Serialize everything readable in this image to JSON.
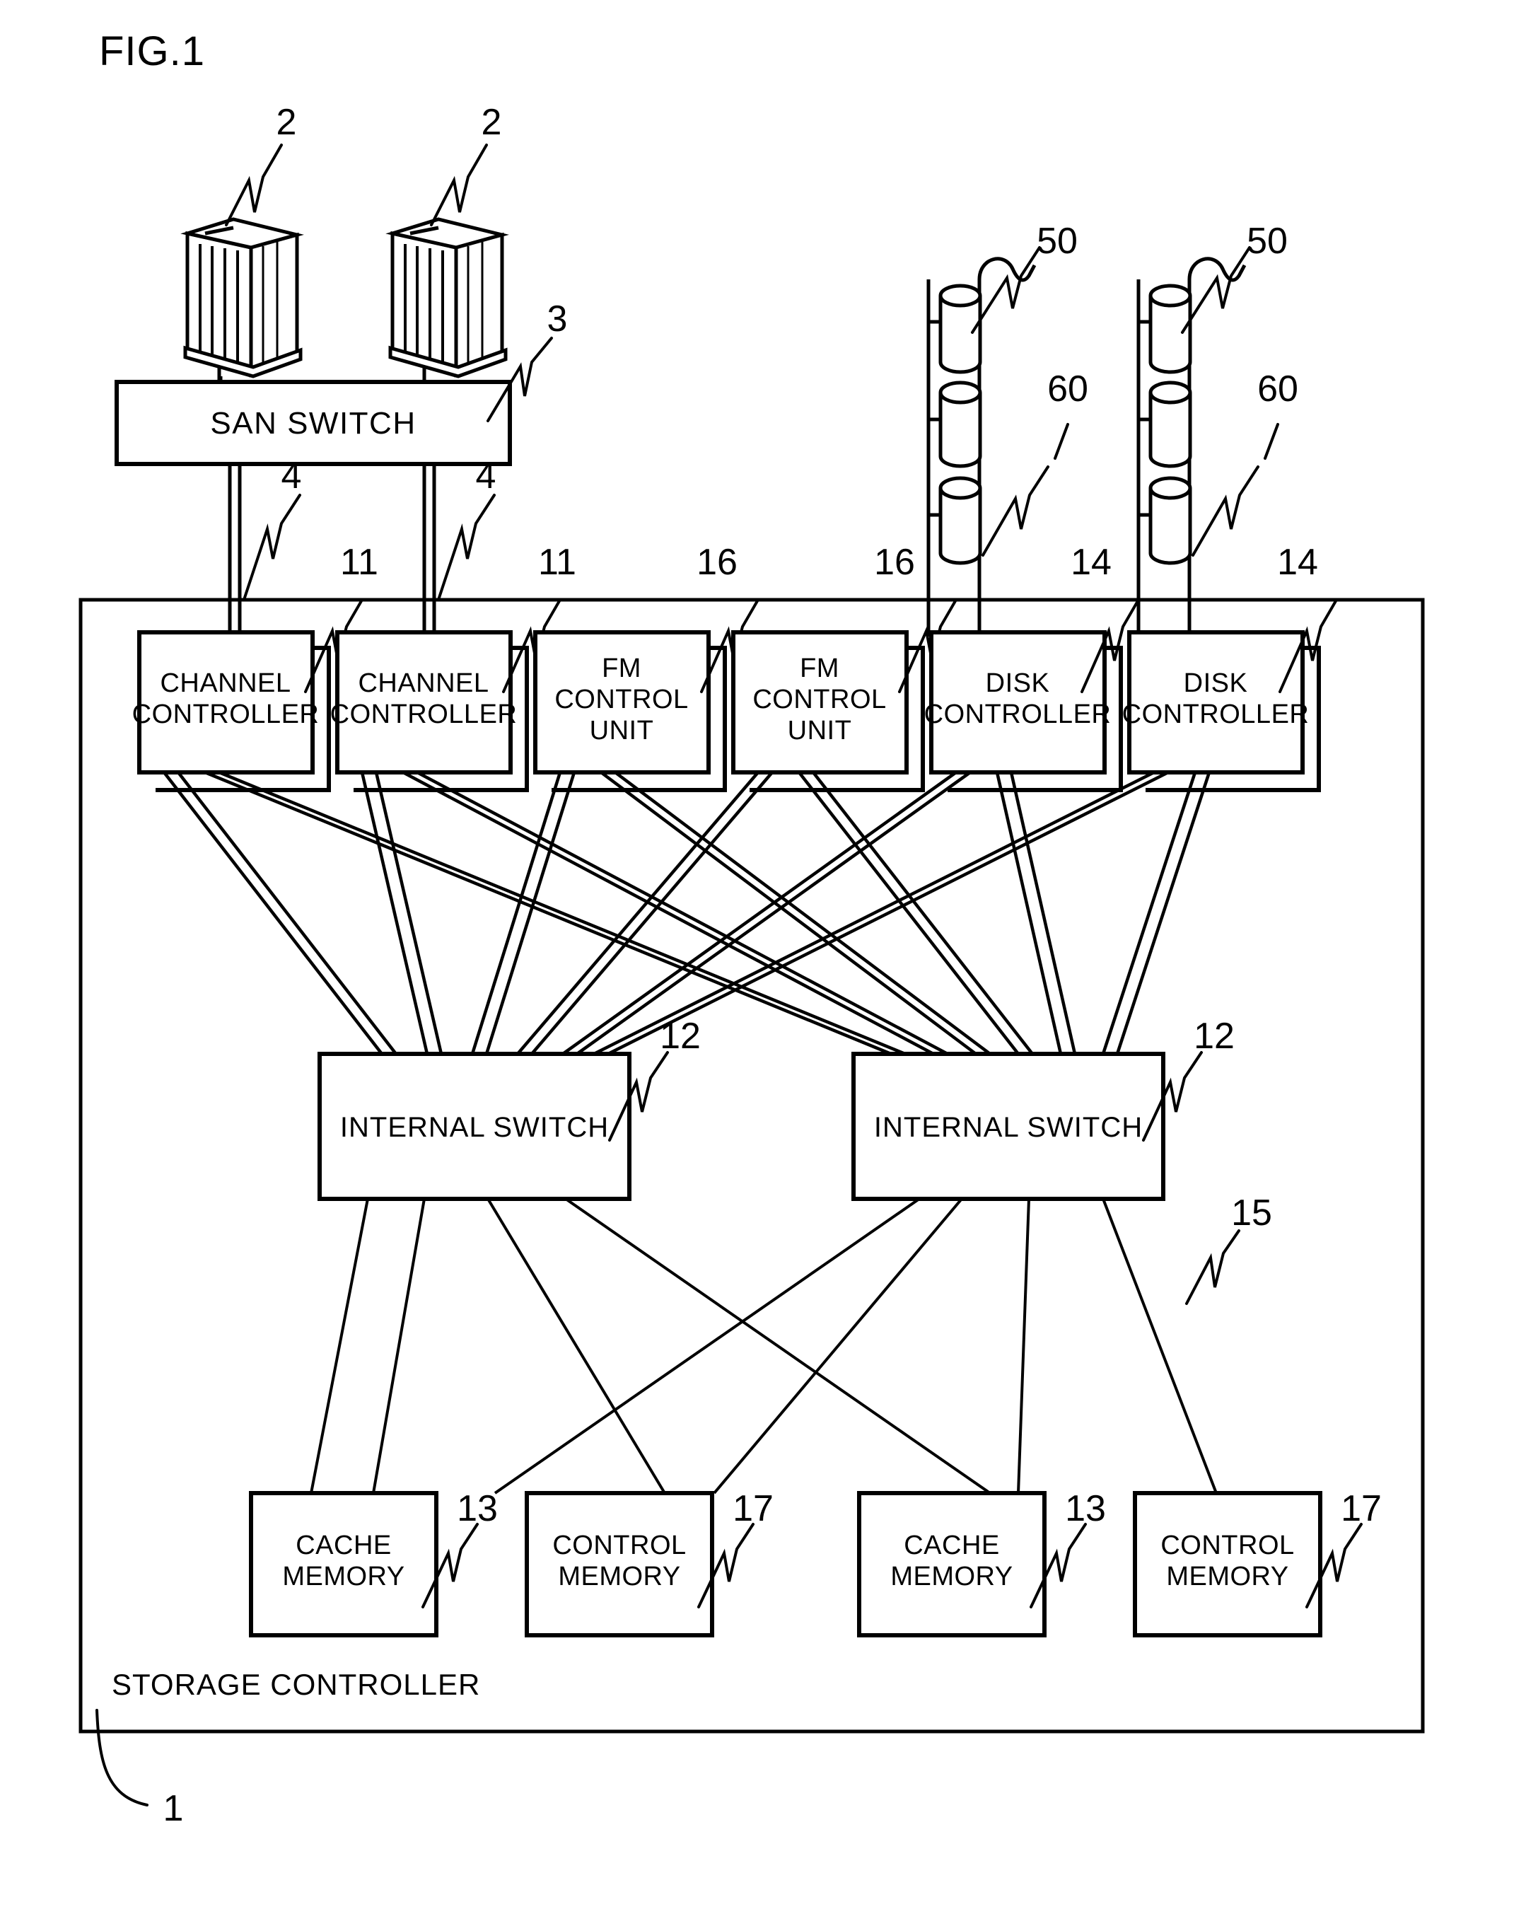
{
  "figure": {
    "title": "FIG.1",
    "frame_label": "STORAGE CONTROLLER",
    "frame_ref": "1"
  },
  "hosts": [
    {
      "name": "host-computer-left",
      "ref": "2"
    },
    {
      "name": "host-computer-right",
      "ref": "2"
    }
  ],
  "san_switch": {
    "label": "SAN SWITCH",
    "ref": "3"
  },
  "host_links": [
    {
      "ref": "4"
    },
    {
      "ref": "4"
    }
  ],
  "controllers": [
    {
      "label_lines": [
        "CHANNEL",
        "CONTROLLER"
      ],
      "ref": "11"
    },
    {
      "label_lines": [
        "CHANNEL",
        "CONTROLLER"
      ],
      "ref": "11"
    },
    {
      "label_lines": [
        "FM",
        "CONTROL",
        "UNIT"
      ],
      "ref": "16"
    },
    {
      "label_lines": [
        "FM",
        "CONTROL",
        "UNIT"
      ],
      "ref": "16"
    },
    {
      "label_lines": [
        "DISK",
        "CONTROLLER"
      ],
      "ref": "14"
    },
    {
      "label_lines": [
        "DISK",
        "CONTROLLER"
      ],
      "ref": "14"
    }
  ],
  "internal_switches": [
    {
      "label": "INTERNAL SWITCH",
      "ref": "12"
    },
    {
      "label": "INTERNAL SWITCH",
      "ref": "12"
    }
  ],
  "internal_link": {
    "ref": "15"
  },
  "memories": [
    {
      "label_lines": [
        "CACHE",
        "MEMORY"
      ],
      "ref": "13"
    },
    {
      "label_lines": [
        "CONTROL",
        "MEMORY"
      ],
      "ref": "17"
    },
    {
      "label_lines": [
        "CACHE",
        "MEMORY"
      ],
      "ref": "13"
    },
    {
      "label_lines": [
        "CONTROL",
        "MEMORY"
      ],
      "ref": "17"
    }
  ],
  "disk_arrays": [
    {
      "disk_ref": "50",
      "bus_ref": "60",
      "disk_count": 3
    },
    {
      "disk_ref": "50",
      "bus_ref": "60",
      "disk_count": 3
    }
  ],
  "colors": {
    "ink": "#000000",
    "paper": "#ffffff"
  }
}
